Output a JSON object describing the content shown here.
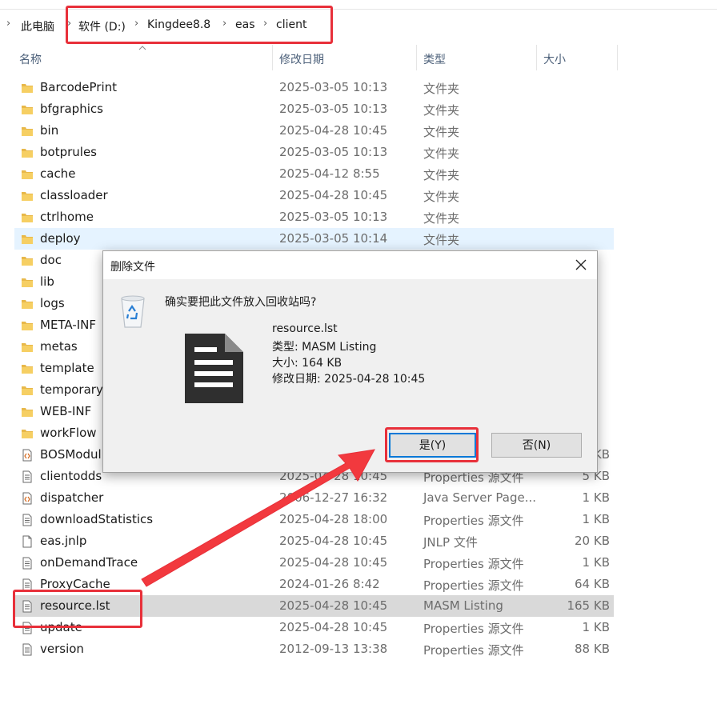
{
  "breadcrumb": {
    "items": [
      "此电脑",
      "软件 (D:)",
      "Kingdee8.8",
      "eas",
      "client"
    ]
  },
  "columns": [
    "名称",
    "修改日期",
    "类型",
    "大小"
  ],
  "files": [
    {
      "name": "BarcodePrint",
      "date": "2025-03-05 10:13",
      "type": "文件夹",
      "size": "",
      "icon": "folder-icon"
    },
    {
      "name": "bfgraphics",
      "date": "2025-03-05 10:13",
      "type": "文件夹",
      "size": "",
      "icon": "folder-icon"
    },
    {
      "name": "bin",
      "date": "2025-04-28 10:45",
      "type": "文件夹",
      "size": "",
      "icon": "folder-icon"
    },
    {
      "name": "botprules",
      "date": "2025-03-05 10:13",
      "type": "文件夹",
      "size": "",
      "icon": "folder-icon"
    },
    {
      "name": "cache",
      "date": "2025-04-12 8:55",
      "type": "文件夹",
      "size": "",
      "icon": "folder-icon"
    },
    {
      "name": "classloader",
      "date": "2025-04-28 10:45",
      "type": "文件夹",
      "size": "",
      "icon": "folder-icon"
    },
    {
      "name": "ctrlhome",
      "date": "2025-03-05 10:13",
      "type": "文件夹",
      "size": "",
      "icon": "folder-icon"
    },
    {
      "name": "deploy",
      "date": "2025-03-05 10:14",
      "type": "文件夹",
      "size": "",
      "icon": "folder-icon"
    },
    {
      "name": "doc",
      "date": "",
      "type": "",
      "size": "",
      "icon": "folder-icon"
    },
    {
      "name": "lib",
      "date": "",
      "type": "",
      "size": "",
      "icon": "folder-icon"
    },
    {
      "name": "logs",
      "date": "",
      "type": "",
      "size": "",
      "icon": "folder-icon"
    },
    {
      "name": "META-INF",
      "date": "",
      "type": "",
      "size": "",
      "icon": "folder-icon"
    },
    {
      "name": "metas",
      "date": "",
      "type": "",
      "size": "",
      "icon": "folder-icon"
    },
    {
      "name": "template",
      "date": "",
      "type": "",
      "size": "",
      "icon": "folder-icon"
    },
    {
      "name": "temporary",
      "date": "",
      "type": "",
      "size": "",
      "icon": "folder-icon"
    },
    {
      "name": "WEB-INF",
      "date": "",
      "type": "",
      "size": "",
      "icon": "folder-icon"
    },
    {
      "name": "workFlow",
      "date": "",
      "type": "",
      "size": "",
      "icon": "folder-icon"
    },
    {
      "name": "BOSModul",
      "date": "",
      "type": "",
      "size": "KB",
      "icon": "xml-file-icon"
    },
    {
      "name": "clientodds",
      "date": "2025-04-28 10:45",
      "type": "Properties 源文件",
      "size": "5 KB",
      "icon": "text-file-icon"
    },
    {
      "name": "dispatcher",
      "date": "2006-12-27 16:32",
      "type": "Java Server Page...",
      "size": "1 KB",
      "icon": "xml-file-icon"
    },
    {
      "name": "downloadStatistics",
      "date": "2025-04-28 18:00",
      "type": "Properties 源文件",
      "size": "1 KB",
      "icon": "text-file-icon"
    },
    {
      "name": "eas.jnlp",
      "date": "2025-04-28 10:45",
      "type": "JNLP 文件",
      "size": "20 KB",
      "icon": "blank-file-icon"
    },
    {
      "name": "onDemandTrace",
      "date": "2025-04-28 10:45",
      "type": "Properties 源文件",
      "size": "1 KB",
      "icon": "text-file-icon"
    },
    {
      "name": "ProxyCache",
      "date": "2024-01-26 8:42",
      "type": "Properties 源文件",
      "size": "64 KB",
      "icon": "text-file-icon"
    },
    {
      "name": "resource.lst",
      "date": "2025-04-28 10:45",
      "type": "MASM Listing",
      "size": "165 KB",
      "icon": "text-file-icon"
    },
    {
      "name": "update",
      "date": "2025-04-28 10:45",
      "type": "Properties 源文件",
      "size": "1 KB",
      "icon": "text-file-icon"
    },
    {
      "name": "version",
      "date": "2012-09-13 13:38",
      "type": "Properties 源文件",
      "size": "88 KB",
      "icon": "text-file-icon"
    }
  ],
  "hover_row": "deploy",
  "selected_row": "resource.lst",
  "dialog": {
    "title": "删除文件",
    "question": "确实要把此文件放入回收站吗?",
    "file_name": "resource.lst",
    "file_type": "类型: MASM Listing",
    "file_size": "大小: 164 KB",
    "file_modified": "修改日期: 2025-04-28 10:45",
    "yes_label": "是(Y)",
    "no_label": "否(N)"
  },
  "colors": {
    "highlight_box": "#e8303a",
    "hover_row": "#e5f3ff",
    "selected_row": "#d9d9d9",
    "primary_button_border": "#0078d7",
    "folder": "#e8b84a"
  }
}
